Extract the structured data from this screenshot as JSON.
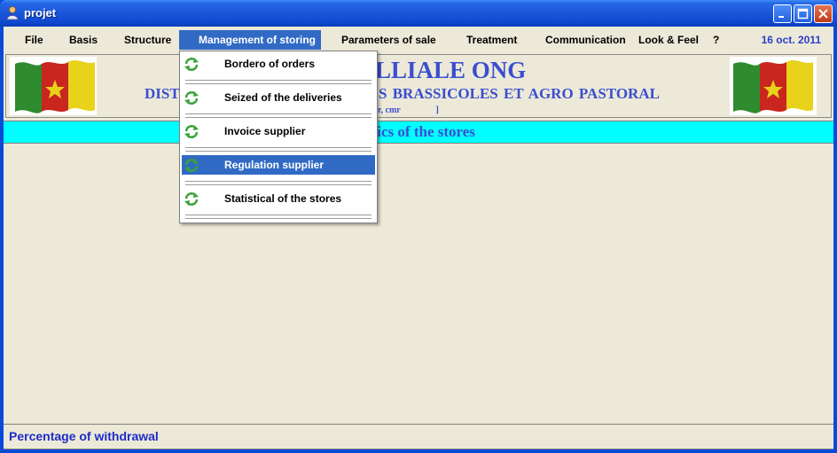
{
  "window": {
    "title": "projet"
  },
  "menubar": {
    "items": [
      {
        "label": "File"
      },
      {
        "label": "Basis"
      },
      {
        "label": "Structure"
      },
      {
        "label": "Management of storing"
      },
      {
        "label": "Parameters of sale"
      },
      {
        "label": "Treatment"
      },
      {
        "label": "Communication"
      },
      {
        "label": "Look & Feel"
      },
      {
        "label": "?"
      }
    ],
    "active_item": "Management of storing",
    "date": "16 oct. 2011"
  },
  "header": {
    "title": "MILLIALE ONG",
    "title_prefix": "DIST",
    "subtitle": "S BRASSICOLES ET AGRO PASTORAL",
    "subline": "ar, cmr                ]"
  },
  "strip": {
    "text": "stics of the stores"
  },
  "dropdown": {
    "items": [
      {
        "label": "Bordero of orders",
        "icon": "refresh-icon"
      },
      {
        "label": "Seized of the deliveries",
        "icon": "refresh-icon"
      },
      {
        "label": "Invoice supplier",
        "icon": "refresh-icon"
      },
      {
        "label": "Regulation supplier",
        "icon": "refresh-icon",
        "selected": true
      },
      {
        "label": "Statistical of the stores",
        "icon": "refresh-icon"
      }
    ]
  },
  "statusbar": {
    "text": "Percentage of withdrawal"
  },
  "colors": {
    "accent": "#316AC5",
    "banner_text": "#3A4ED0",
    "strip_bg": "#00FFFF"
  }
}
